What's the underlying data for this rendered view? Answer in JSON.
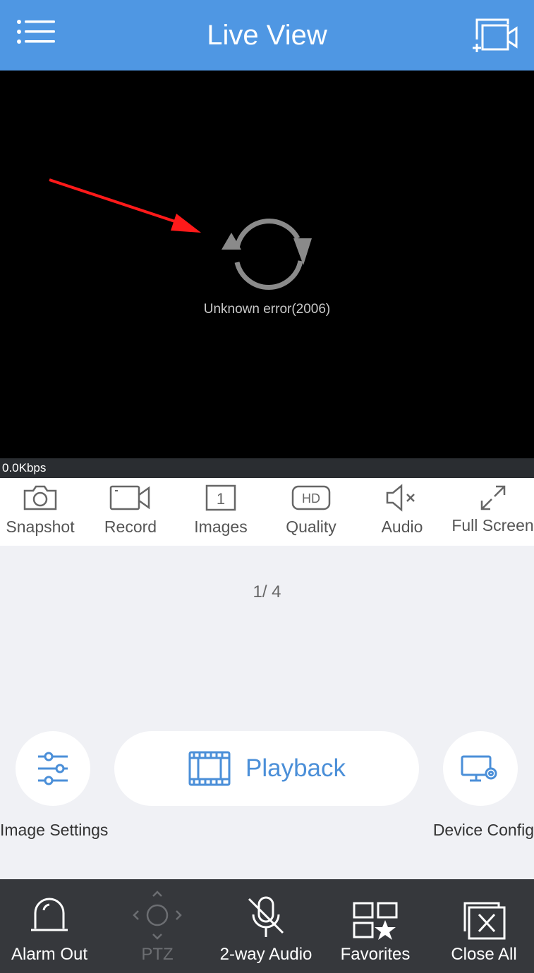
{
  "header": {
    "title": "Live View",
    "menu_icon": "menu-icon",
    "add_view_icon": "add-window-icon"
  },
  "video": {
    "error_message": "Unknown error(2006)",
    "bitrate": "0.0Kbps",
    "icon": "refresh-icon"
  },
  "toolbar": {
    "items": [
      {
        "label": "Snapshot",
        "icon": "camera-icon"
      },
      {
        "label": "Record",
        "icon": "video-camera-icon"
      },
      {
        "label": "Images",
        "icon": "layout-count-icon",
        "badge": "1"
      },
      {
        "label": "Quality",
        "icon": "hd-icon",
        "badge": "HD"
      },
      {
        "label": "Audio",
        "icon": "speaker-muted-icon"
      },
      {
        "label": "Full Screen",
        "icon": "expand-icon"
      }
    ]
  },
  "pager": {
    "text": "1/ 4"
  },
  "actions": {
    "image_settings": {
      "label": "Image Settings",
      "icon": "sliders-icon"
    },
    "playback": {
      "label": "Playback",
      "icon": "film-icon"
    },
    "device_config": {
      "label": "Device Config",
      "icon": "monitor-gear-icon"
    }
  },
  "bottom_bar": {
    "items": [
      {
        "label": "Alarm Out",
        "icon": "alarm-light-icon"
      },
      {
        "label": "PTZ",
        "icon": "ptz-icon",
        "disabled": true
      },
      {
        "label": "2-way Audio",
        "icon": "microphone-muted-icon"
      },
      {
        "label": "Favorites",
        "icon": "favorites-grid-star-icon"
      },
      {
        "label": "Close All",
        "icon": "close-windows-icon"
      }
    ]
  },
  "colors": {
    "header_bg": "#4f97e3",
    "accent": "#4b8fd8",
    "bottom_bar_bg": "#36383c",
    "page_bg": "#f0f1f5"
  }
}
